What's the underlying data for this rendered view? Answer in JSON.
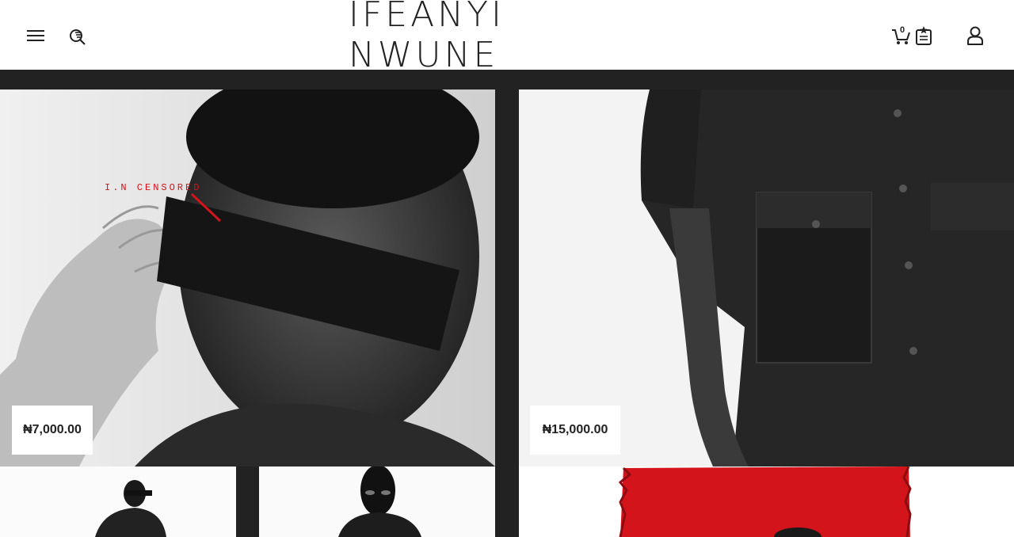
{
  "header": {
    "brand": "IFEANYI NWUNE",
    "cart_count": "0",
    "icons": {
      "menu": "hamburger-menu-icon",
      "search": "search-icon",
      "cart": "shopping-cart-icon",
      "wishlist": "wishlist-clipboard-star-icon",
      "account": "user-account-icon"
    }
  },
  "products": [
    {
      "price": "₦7,000.00",
      "image_text": "I.N CENSORED"
    },
    {
      "price": "₦15,000.00"
    }
  ],
  "colors": {
    "header_bg": "#ffffff",
    "page_bg": "#222222",
    "accent_red": "#d3141b"
  }
}
